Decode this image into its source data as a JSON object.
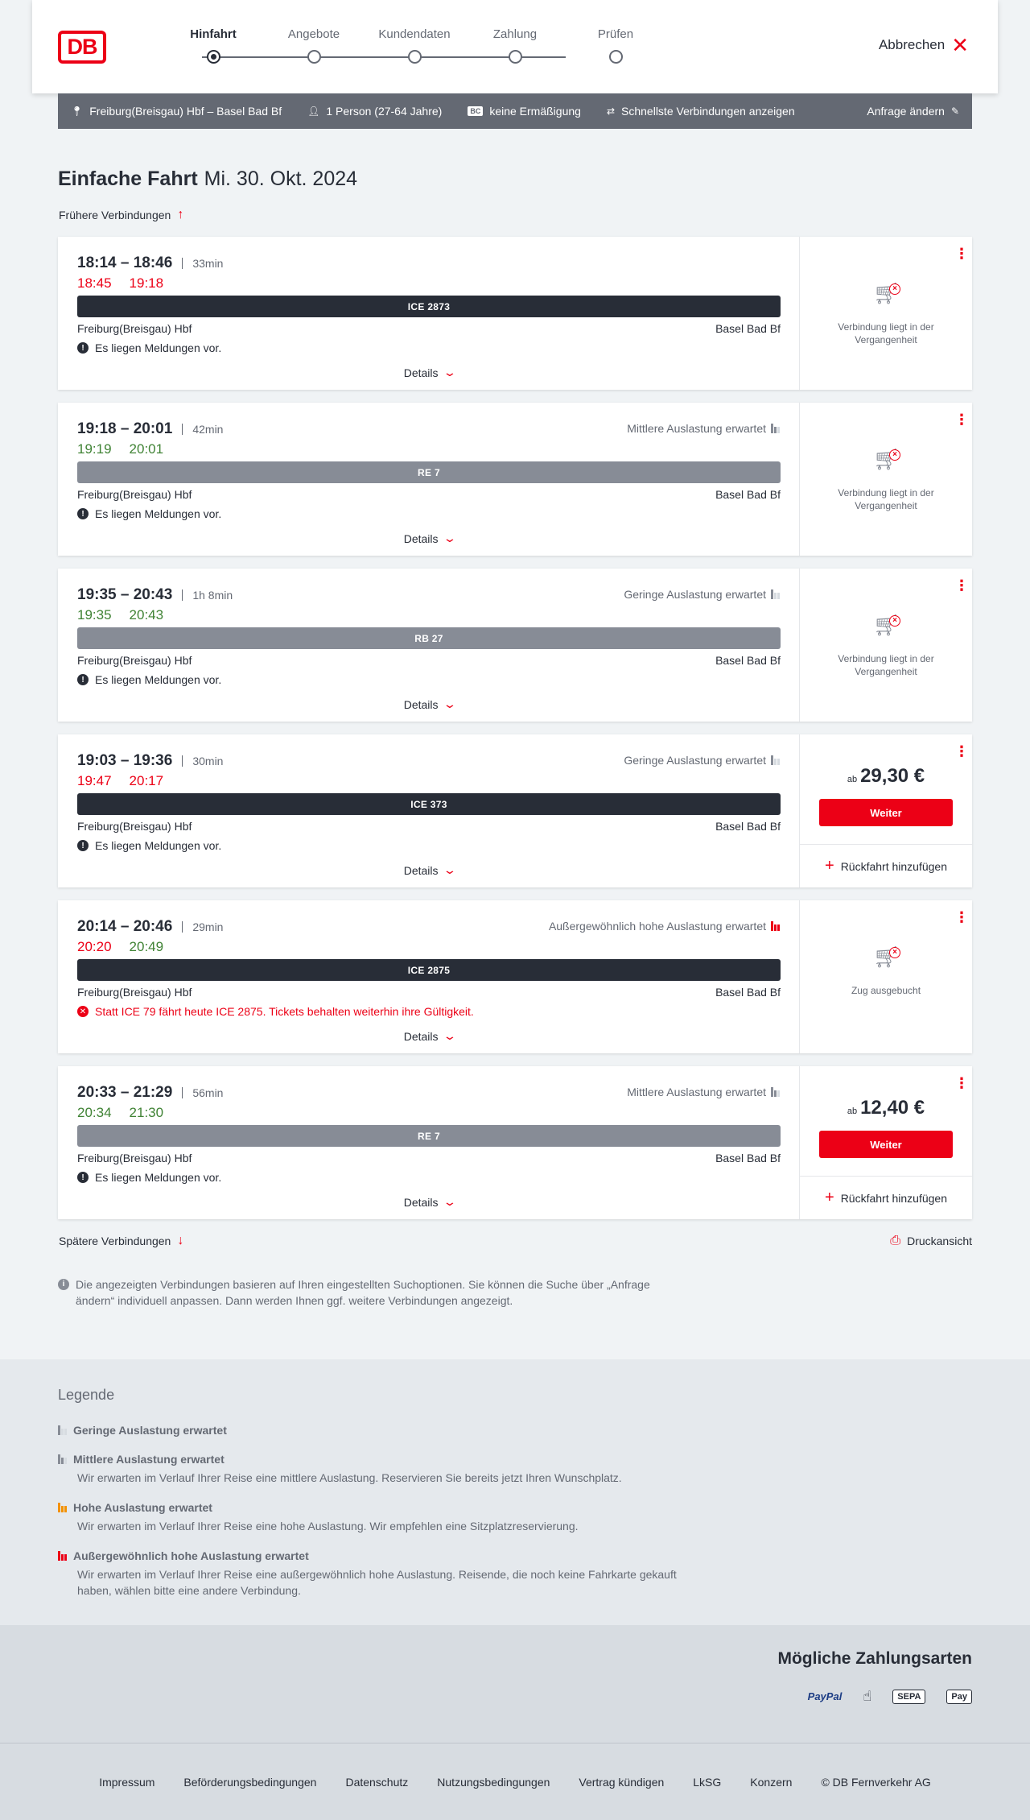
{
  "header": {
    "logo": "DB",
    "steps": [
      "Hinfahrt",
      "Angebote",
      "Kundendaten",
      "Zahlung",
      "Prüfen"
    ],
    "active_step": "Hinfahrt",
    "cancel_label": "Abbrechen"
  },
  "summary": {
    "route": "Freiburg(Breisgau) Hbf – Basel Bad Bf",
    "passengers": "1 Person (27-64 Jahre)",
    "bahncard_badge": "BC",
    "discount": "keine Ermäßigung",
    "fastest": "Schnellste Verbindungen anzeigen",
    "change": "Anfrage ändern"
  },
  "page": {
    "title": "Einfache Fahrt",
    "date": "Mi. 30. Okt. 2024",
    "earlier": "Frühere Verbindungen",
    "later": "Spätere Verbindungen",
    "print": "Druckansicht",
    "details_label": "Details",
    "price_prefix": "ab",
    "weiter_label": "Weiter",
    "rueckfahrt_label": "Rückfahrt hinzufügen",
    "info": "Die angezeigten Verbindungen basieren auf Ihren eingestellten Suchoptionen. Sie können die Suche über „Anfrage ändern“ individuell anpassen. Dann werden Ihnen ggf. weitere Verbindungen angezeigt."
  },
  "connections": [
    {
      "times": "18:14 – 18:46",
      "duration": "33min",
      "rt_dep": "18:45",
      "rt_arr": "19:18",
      "rt_status": "late",
      "load": "",
      "train": "ICE 2873",
      "train_type": "ice",
      "from": "Freiburg(Breisgau) Hbf",
      "to": "Basel Bad Bf",
      "message": "Es liegen Meldungen vor.",
      "message_type": "info",
      "status": "Verbindung liegt in der Vergangenheit"
    },
    {
      "times": "19:18 – 20:01",
      "duration": "42min",
      "rt_dep": "19:19",
      "rt_arr": "20:01",
      "rt_status": "ontime",
      "load": "Mittlere Auslastung erwartet",
      "load_level": 2,
      "train": "RE 7",
      "train_type": "re",
      "from": "Freiburg(Breisgau) Hbf",
      "to": "Basel Bad Bf",
      "message": "Es liegen Meldungen vor.",
      "message_type": "info",
      "status": "Verbindung liegt in der Vergangenheit"
    },
    {
      "times": "19:35 – 20:43",
      "duration": "1h 8min",
      "rt_dep": "19:35",
      "rt_arr": "20:43",
      "rt_status": "ontime",
      "load": "Geringe Auslastung erwartet",
      "load_level": 1,
      "train": "RB 27",
      "train_type": "re",
      "from": "Freiburg(Breisgau) Hbf",
      "to": "Basel Bad Bf",
      "message": "Es liegen Meldungen vor.",
      "message_type": "info",
      "status": "Verbindung liegt in der Vergangenheit"
    },
    {
      "times": "19:03 – 19:36",
      "duration": "30min",
      "rt_dep": "19:47",
      "rt_arr": "20:17",
      "rt_status": "late",
      "load": "Geringe Auslastung erwartet",
      "load_level": 1,
      "train": "ICE 373",
      "train_type": "ice",
      "from": "Freiburg(Breisgau) Hbf",
      "to": "Basel Bad Bf",
      "message": "Es liegen Meldungen vor.",
      "message_type": "info",
      "price": "29,30 €"
    },
    {
      "times": "20:14 – 20:46",
      "duration": "29min",
      "rt_dep": "20:20",
      "rt_arr": "20:49",
      "rt_status": "mixed",
      "load": "Außergewöhnlich hohe Auslastung erwartet",
      "load_level": 4,
      "train": "ICE 2875",
      "train_type": "ice",
      "from": "Freiburg(Breisgau) Hbf",
      "to": "Basel Bad Bf",
      "message": "Statt ICE 79 fährt heute ICE 2875. Tickets behalten weiterhin ihre Gültigkeit.",
      "message_type": "error",
      "status": "Zug ausgebucht"
    },
    {
      "times": "20:33 – 21:29",
      "duration": "56min",
      "rt_dep": "20:34",
      "rt_arr": "21:30",
      "rt_status": "ontime",
      "load": "Mittlere Auslastung erwartet",
      "load_level": 2,
      "train": "RE 7",
      "train_type": "re",
      "from": "Freiburg(Breisgau) Hbf",
      "to": "Basel Bad Bf",
      "message": "Es liegen Meldungen vor.",
      "message_type": "info",
      "price": "12,40 €"
    }
  ],
  "legend": {
    "title": "Legende",
    "items": [
      {
        "title": "Geringe Auslastung erwartet",
        "desc": ""
      },
      {
        "title": "Mittlere Auslastung erwartet",
        "desc": "Wir erwarten im Verlauf Ihrer Reise eine mittlere Auslastung. Reservieren Sie bereits jetzt Ihren Wunschplatz."
      },
      {
        "title": "Hohe Auslastung erwartet",
        "desc": "Wir erwarten im Verlauf Ihrer Reise eine hohe Auslastung. Wir empfehlen eine Sitzplatzreservierung."
      },
      {
        "title": "Außergewöhnlich hohe Auslastung erwartet",
        "desc": "Wir erwarten im Verlauf Ihrer Reise eine außergewöhnlich hohe Auslastung. Reisende, die noch keine Fahrkarte gekauft haben, wählen bitte eine andere Verbindung."
      }
    ]
  },
  "payment": {
    "title": "Mögliche Zahlungsarten",
    "methods": [
      "PayPal",
      "SEPA",
      "Pay"
    ]
  },
  "footer": {
    "links": [
      "Impressum",
      "Beförderungsbedingungen",
      "Datenschutz",
      "Nutzungsbedingungen",
      "Vertrag kündigen",
      "LkSG",
      "Konzern",
      "© DB Fernverkehr AG"
    ]
  },
  "colors": {
    "accent": "#ec0016",
    "late": "#ec0016",
    "ontime": "#408335",
    "dark": "#282d37",
    "bar": "#646973"
  }
}
